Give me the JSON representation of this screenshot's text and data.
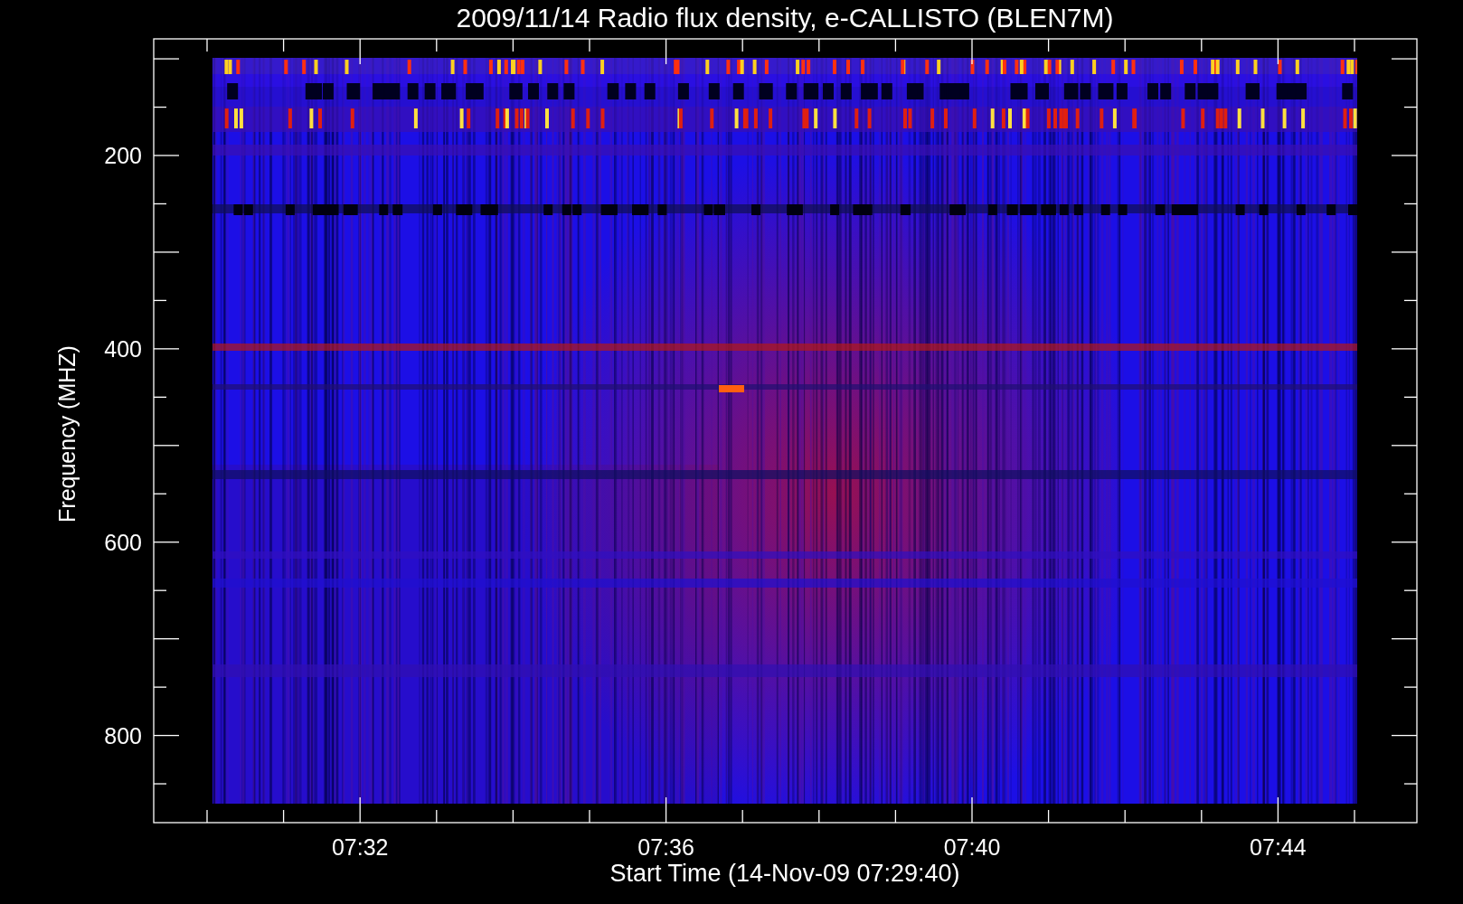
{
  "title": "2009/11/14  Radio flux density, e-CALLISTO (BLEN7M)",
  "y_axis": {
    "label": "Frequency (MHZ)",
    "ticks": [
      "200",
      "400",
      "600",
      "800"
    ]
  },
  "x_axis": {
    "label": "Start Time (14-Nov-09 07:29:40)",
    "ticks": [
      "07:32",
      "07:36",
      "07:40",
      "07:44"
    ]
  }
}
